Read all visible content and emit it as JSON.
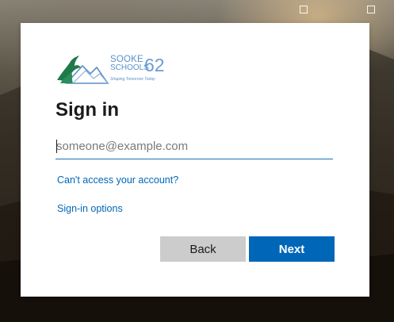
{
  "background": {
    "icons": [
      "window-icon",
      "window-icon"
    ]
  },
  "logo": {
    "line1": "SOOKE",
    "line2": "SCHOOLS",
    "number": "62",
    "tagline": "Shaping Tomorrow Today",
    "colors": {
      "text": "#5a8fc9",
      "tree": "#1e7a4a",
      "mountain": "#5a8fc9"
    }
  },
  "signin": {
    "title": "Sign in",
    "email_placeholder": "someone@example.com",
    "email_value": "",
    "cant_access_link": "Can't access your account?",
    "signin_options_link": "Sign-in options",
    "back_label": "Back",
    "next_label": "Next"
  },
  "colors": {
    "accent": "#0067b8",
    "back_button": "#cccccc",
    "card": "#ffffff"
  }
}
